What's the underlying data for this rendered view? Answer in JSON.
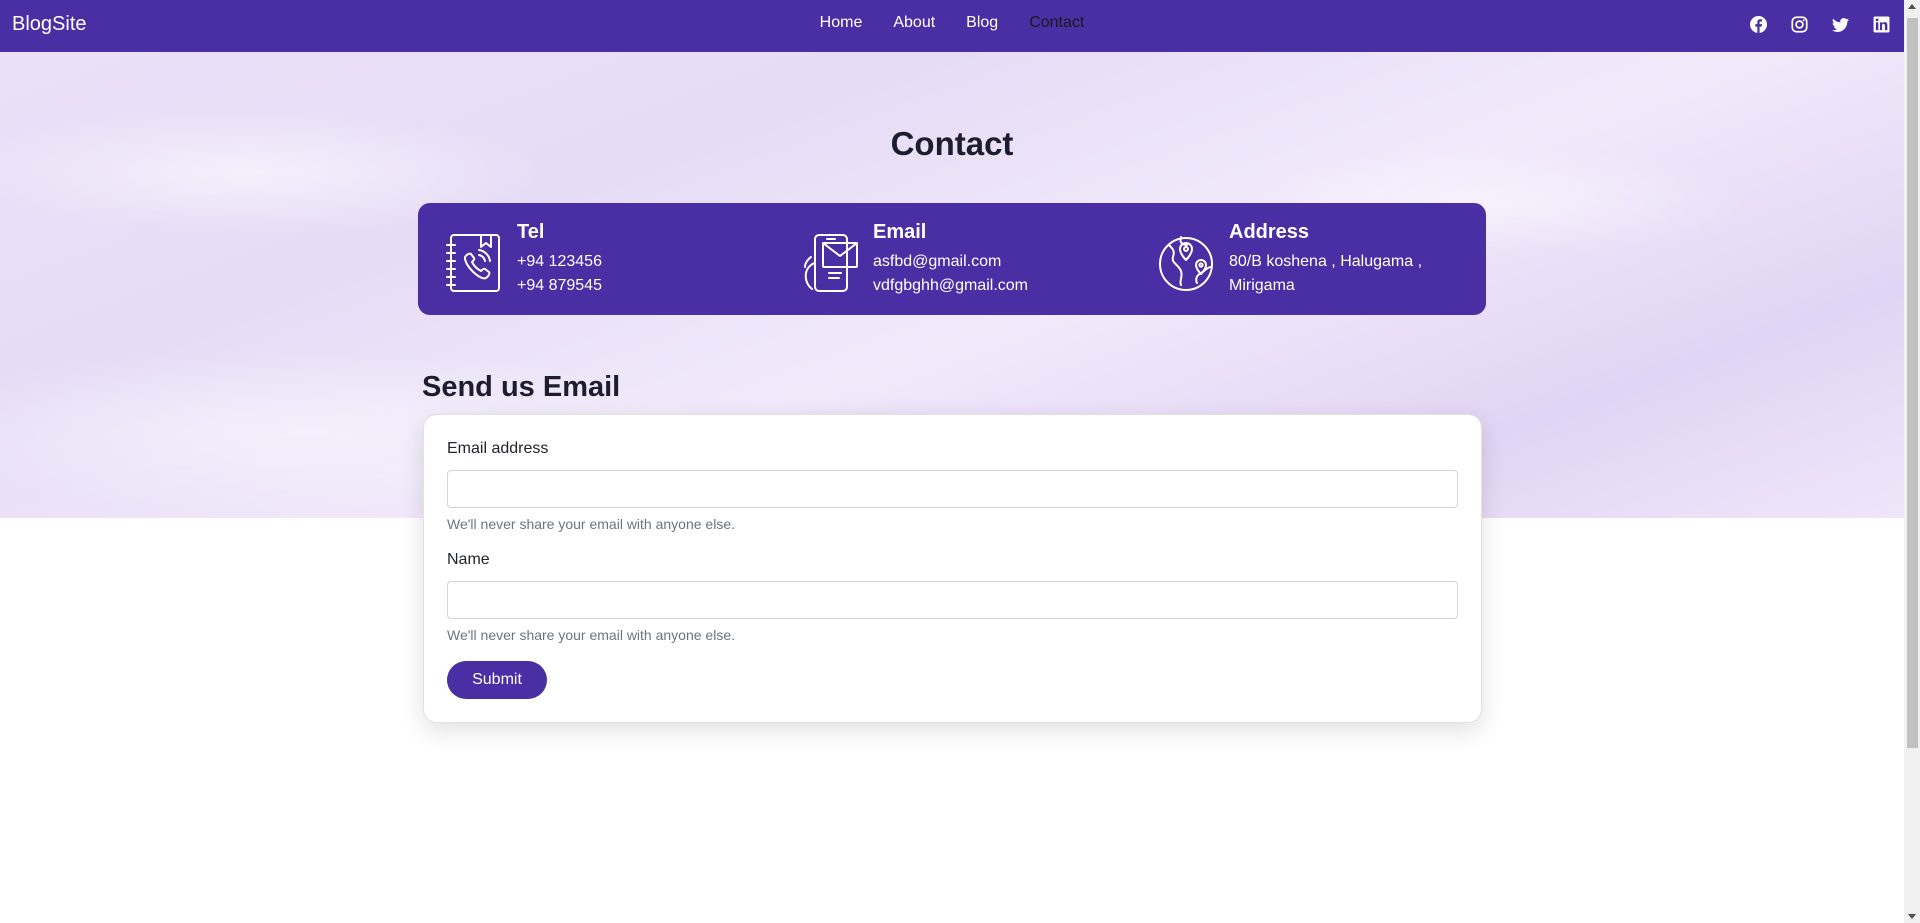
{
  "navbar": {
    "brand": "BlogSite",
    "links": [
      {
        "label": "Home"
      },
      {
        "label": "About"
      },
      {
        "label": "Blog"
      },
      {
        "label": "Contact",
        "active": true
      }
    ],
    "socials": [
      "facebook-icon",
      "instagram-icon",
      "twitter-icon",
      "linkedin-icon"
    ]
  },
  "page": {
    "title": "Contact"
  },
  "info": {
    "tel": {
      "title": "Tel",
      "lines": [
        "+94 123456",
        "+94 879545"
      ],
      "icon": "phone-book-icon"
    },
    "email": {
      "title": "Email",
      "lines": [
        "asfbd@gmail.com",
        "vdfgbghh@gmail.com"
      ],
      "icon": "mobile-mail-icon"
    },
    "address": {
      "title": "Address",
      "lines": [
        "80/B koshena , Halugama ,",
        "Mirigama"
      ],
      "icon": "globe-pin-icon"
    }
  },
  "form": {
    "heading": "Send us Email",
    "email_label": "Email address",
    "email_value": "",
    "email_help": "We'll never share your email with anyone else.",
    "name_label": "Name",
    "name_value": "",
    "name_help": "We'll never share your email with anyone else.",
    "submit_label": "Submit"
  },
  "colors": {
    "primary": "#4a2ea3",
    "hero_background": "#ece0f8"
  }
}
